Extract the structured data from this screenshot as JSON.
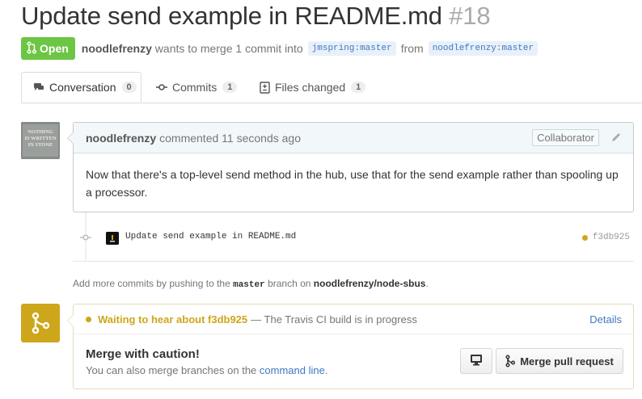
{
  "pr": {
    "title": "Update send example in README.md",
    "number": "#18",
    "state": "Open",
    "author": "noodlefrenzy",
    "merge_text": "wants to merge 1 commit into",
    "base_branch": "jmspring:master",
    "from_text": "from",
    "head_branch": "noodlefrenzy:master"
  },
  "tabs": [
    {
      "label": "Conversation",
      "count": "0",
      "icon": "comment-icon"
    },
    {
      "label": "Commits",
      "count": "1",
      "icon": "commit-icon"
    },
    {
      "label": "Files changed",
      "count": "1",
      "icon": "diff-icon"
    }
  ],
  "comment": {
    "author": "noodlefrenzy",
    "action": "commented 11 seconds ago",
    "role": "Collaborator",
    "body": "Now that there's a top-level send method in the hub, use that for the send example rather than spooling up a processor.",
    "avatar_text": "NOTHING IS WRITTEN IN STONE"
  },
  "commit": {
    "message": "Update send example in README.md",
    "sha": "f3db925",
    "status_color": "#cea61b"
  },
  "help": {
    "prefix": "Add more commits by pushing to the",
    "branch": "master",
    "middle": "branch on",
    "repo": "noodlefrenzy/node-sbus",
    "suffix": "."
  },
  "merge": {
    "status_strong": "Waiting to hear about f3db925",
    "status_desc": "— The Travis CI build is in progress",
    "details_label": "Details",
    "title": "Merge with caution!",
    "sub_prefix": "You can also merge branches on the",
    "sub_link": "command line",
    "sub_suffix": ".",
    "button_label": "Merge pull request",
    "accent_color": "#cea61b"
  }
}
